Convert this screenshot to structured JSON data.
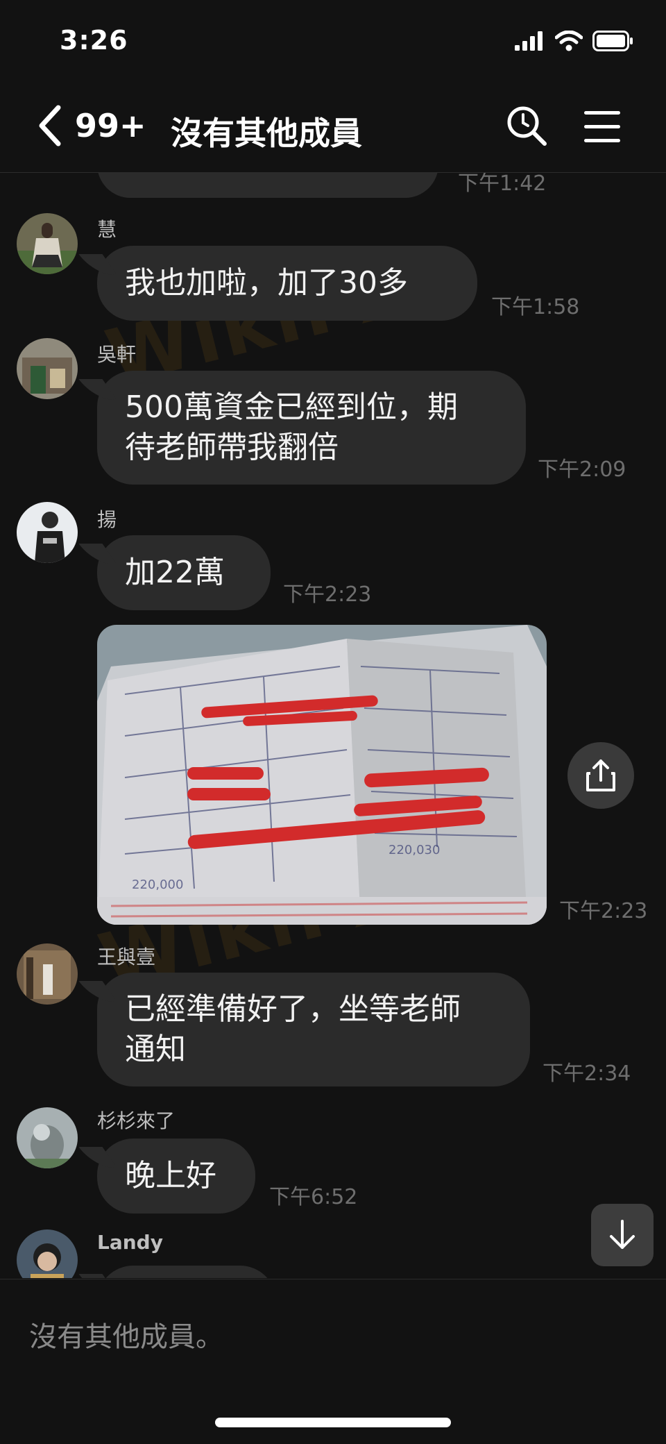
{
  "status_bar": {
    "time": "3:26"
  },
  "header": {
    "back_badge": "99+",
    "title": "沒有其他成員"
  },
  "messages": [
    {
      "sender": "",
      "text": "",
      "timestamp": "下午1:42"
    },
    {
      "sender": "慧",
      "text": "我也加啦，加了30多",
      "timestamp": "下午1:58"
    },
    {
      "sender": "吳軒",
      "text_line1": "500萬資金已經到位，期",
      "text_line2": "待老師帶我翻倍",
      "timestamp": "下午2:09"
    },
    {
      "sender": "揚",
      "text": "加22萬",
      "timestamp": "下午2:23"
    },
    {
      "sender": "",
      "type": "image",
      "timestamp": "下午2:23"
    },
    {
      "sender": "王與壹",
      "text_line1": "已經準備好了，坐等老師",
      "text_line2": "通知",
      "timestamp": "下午2:34"
    },
    {
      "sender": "杉杉來了",
      "text": "晚上好",
      "timestamp": "下午6:52"
    },
    {
      "sender": "Landy",
      "text": ""
    }
  ],
  "watermark": "WikiFX",
  "input": {
    "placeholder": "沒有其他成員。"
  },
  "colors": {
    "background": "#121212",
    "bubble": "#2b2b2b",
    "timestamp": "#6e6e6e"
  },
  "icons": [
    "back-chevron-icon",
    "search-icon",
    "menu-icon",
    "share-icon",
    "arrow-down-icon",
    "signal-icon",
    "wifi-icon",
    "battery-icon"
  ]
}
